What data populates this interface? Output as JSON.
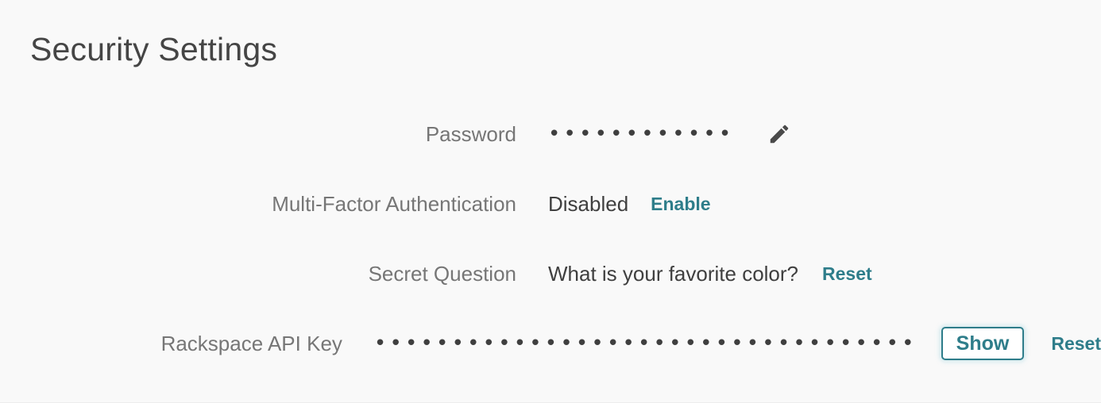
{
  "page": {
    "title": "Security Settings",
    "background_color": "#f9f9f9",
    "title_color": "#454545",
    "label_color": "#767676",
    "value_color": "#3f3f3f",
    "accent_color": "#2e7d8a"
  },
  "settings": {
    "rows": [
      {
        "label": "Password",
        "value": "••••••••••••",
        "value_masked": true,
        "edit_icon": "pencil-icon"
      },
      {
        "label": "Multi-Factor Authentication",
        "value": "Disabled",
        "value_masked": false,
        "action": "Enable"
      },
      {
        "label": "Secret Question",
        "value": "What is your favorite color?",
        "value_masked": false,
        "action": "Reset"
      },
      {
        "label": "Rackspace API Key",
        "value": "•••••••••••••••••••••••••••••••••••",
        "value_masked": true,
        "button": "Show",
        "action": "Reset"
      }
    ]
  }
}
